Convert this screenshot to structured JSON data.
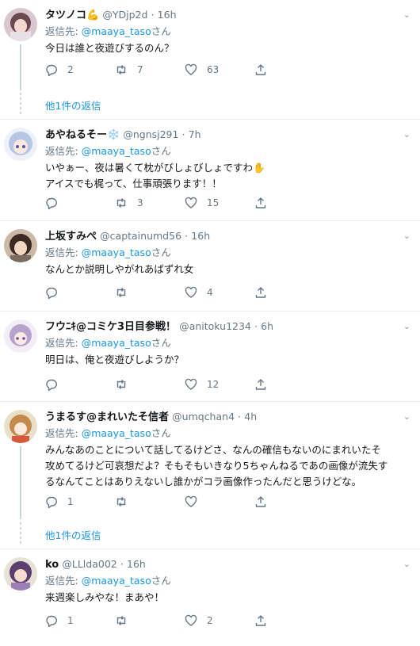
{
  "reply_prefix": "返信先: ",
  "reply_suffix": "さん",
  "time_sep": "·",
  "mention_color": "#1b95e0",
  "tweets": [
    {
      "display_name": "タツノコ",
      "badge_emoji": "💪",
      "handle": "@YDjp2d",
      "time": "16h",
      "reply_to": "@maaya_taso",
      "text_lines": [
        "今日は誰と夜遊びするのん？"
      ],
      "counts": {
        "reply": "2",
        "retweet": "7",
        "like": "63"
      },
      "avatar_icon": "avatar-pink-hair-icon"
    },
    {
      "display_name": "あやねるそー",
      "badge_emoji": "❄️",
      "handle": "@ngnsj291",
      "time": "7h",
      "reply_to": "@maaya_taso",
      "text_lines": [
        "いやぁー、夜は暑くて枕がびしょびしょですわ✋",
        "アイスでも梶って、仕事頑張ります！！"
      ],
      "counts": {
        "reply": "",
        "retweet": "3",
        "like": "15"
      },
      "avatar_icon": "avatar-blue-hair-icon"
    },
    {
      "display_name": "上坂すみぺ",
      "badge_emoji": "",
      "handle": "@captainumd56",
      "time": "16h",
      "reply_to": "@maaya_taso",
      "text_lines": [
        "なんとか説明しやがれあばずれ女"
      ],
      "counts": {
        "reply": "",
        "retweet": "",
        "like": "4"
      },
      "avatar_icon": "avatar-dark-hair-icon"
    },
    {
      "display_name": "フウﾆｷ@コミケ3日目参戦！",
      "badge_emoji": "",
      "handle": "@anitoku1234",
      "time": "6h",
      "reply_to": "@maaya_taso",
      "text_lines": [
        "明日は、俺と夜遊びしようか？"
      ],
      "counts": {
        "reply": "",
        "retweet": "",
        "like": "12"
      },
      "avatar_icon": "avatar-lavender-hair-icon"
    },
    {
      "display_name": "うまるす@まれいたそ信者",
      "badge_emoji": "",
      "handle": "@umqchan4",
      "time": "4h",
      "reply_to": "@maaya_taso",
      "text_lines": [
        "みんなあのことについて話してるけどさ、なんの確信もないのにまれいたそ",
        "攻めてるけど可哀想だよ？そもそもいきなり5ちゃんねるであの画像が流失す",
        "るなんてことはありえないし誰かがコラ画像作ったんだと思うけどな。"
      ],
      "counts": {
        "reply": "1",
        "retweet": "",
        "like": ""
      },
      "avatar_icon": "avatar-brown-hair-icon"
    },
    {
      "display_name": "ko",
      "badge_emoji": "",
      "handle": "@LLlda002",
      "time": "16h",
      "reply_to": "@maaya_taso",
      "text_lines": [
        "来週楽しみやな！まあや！"
      ],
      "counts": {
        "reply": "1",
        "retweet": "",
        "like": "2"
      },
      "avatar_icon": "avatar-purple-hair-icon"
    }
  ],
  "more_replies": [
    "他1件の返信",
    "他1件の返信"
  ],
  "icons": {
    "reply": "reply-icon",
    "retweet": "retweet-icon",
    "like": "heart-icon",
    "share": "share-icon",
    "menu": "chevron-down-icon"
  }
}
